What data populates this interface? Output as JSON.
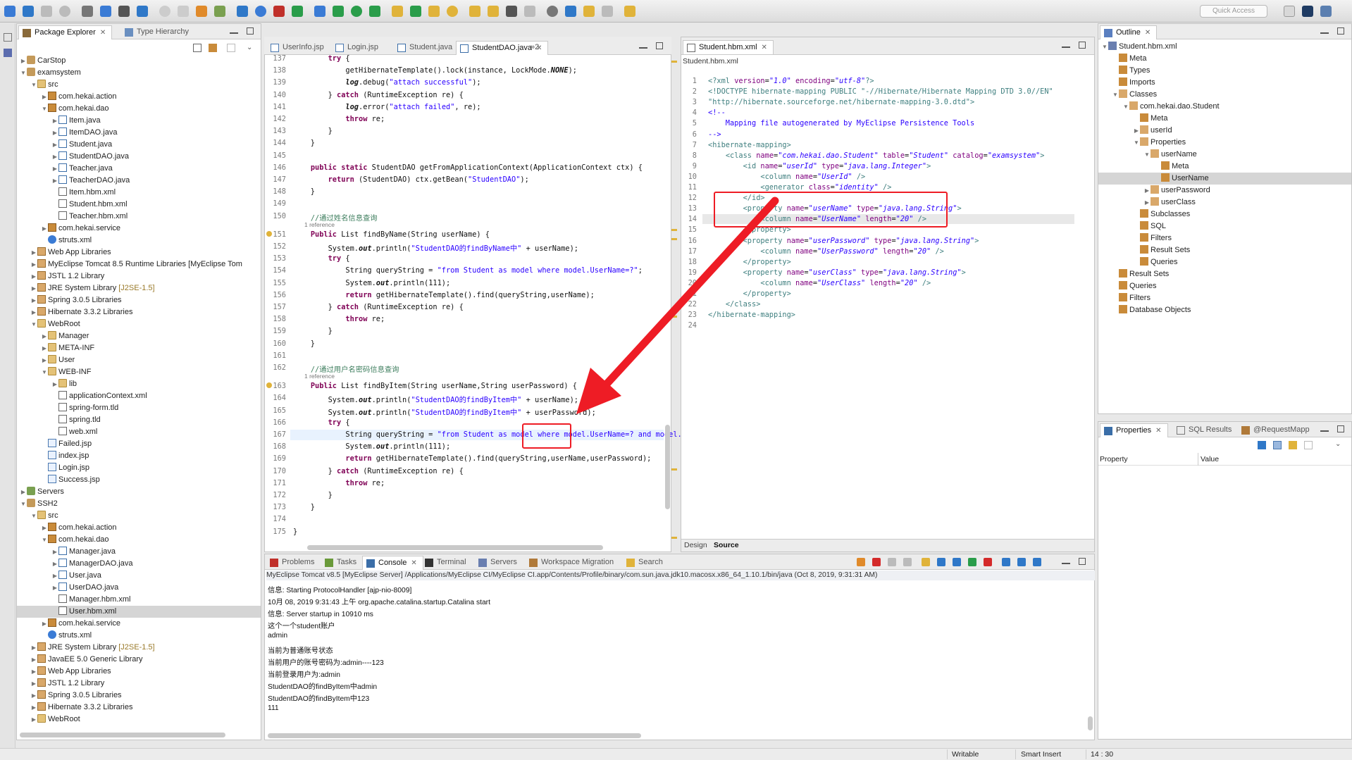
{
  "toolbar": {
    "quick_access_placeholder": "Quick Access"
  },
  "left": {
    "tabs": [
      {
        "label": "Package Explorer"
      },
      {
        "label": "Type Hierarchy"
      }
    ],
    "tree": [
      {
        "d": 0,
        "a": "▶",
        "i": "proj",
        "t": "CarStop"
      },
      {
        "d": 0,
        "a": "▼",
        "i": "proj",
        "t": "examsystem"
      },
      {
        "d": 1,
        "a": "▼",
        "i": "fold",
        "t": "src"
      },
      {
        "d": 2,
        "a": "▶",
        "i": "pkg",
        "t": "com.hekai.action"
      },
      {
        "d": 2,
        "a": "▼",
        "i": "pkg",
        "t": "com.hekai.dao"
      },
      {
        "d": 3,
        "a": "▶",
        "i": "java",
        "t": "Item.java"
      },
      {
        "d": 3,
        "a": "▶",
        "i": "java",
        "t": "ItemDAO.java"
      },
      {
        "d": 3,
        "a": "▶",
        "i": "java",
        "t": "Student.java"
      },
      {
        "d": 3,
        "a": "▶",
        "i": "java",
        "t": "StudentDAO.java"
      },
      {
        "d": 3,
        "a": "▶",
        "i": "java",
        "t": "Teacher.java"
      },
      {
        "d": 3,
        "a": "▶",
        "i": "java",
        "t": "TeacherDAO.java"
      },
      {
        "d": 3,
        "a": "",
        "i": "xml",
        "t": "Item.hbm.xml"
      },
      {
        "d": 3,
        "a": "",
        "i": "xml",
        "t": "Student.hbm.xml"
      },
      {
        "d": 3,
        "a": "",
        "i": "xml",
        "t": "Teacher.hbm.xml"
      },
      {
        "d": 2,
        "a": "▶",
        "i": "pkg",
        "t": "com.hekai.service"
      },
      {
        "d": 2,
        "a": "",
        "i": "gear",
        "t": "struts.xml"
      },
      {
        "d": 1,
        "a": "▶",
        "i": "lib",
        "t": "Web App Libraries"
      },
      {
        "d": 1,
        "a": "▶",
        "i": "lib",
        "t": "MyEclipse Tomcat 8.5 Runtime Libraries [MyEclipse Tom"
      },
      {
        "d": 1,
        "a": "▶",
        "i": "lib",
        "t": "JSTL 1.2 Library"
      },
      {
        "d": 1,
        "a": "▶",
        "i": "lib",
        "t": "JRE System Library ",
        "x": "[J2SE-1.5]"
      },
      {
        "d": 1,
        "a": "▶",
        "i": "lib",
        "t": "Spring 3.0.5 Libraries"
      },
      {
        "d": 1,
        "a": "▶",
        "i": "lib",
        "t": "Hibernate 3.3.2 Libraries"
      },
      {
        "d": 1,
        "a": "▼",
        "i": "fold",
        "t": "WebRoot"
      },
      {
        "d": 2,
        "a": "▶",
        "i": "fold",
        "t": "Manager"
      },
      {
        "d": 2,
        "a": "▶",
        "i": "fold",
        "t": "META-INF"
      },
      {
        "d": 2,
        "a": "▶",
        "i": "fold",
        "t": "User"
      },
      {
        "d": 2,
        "a": "▼",
        "i": "fold",
        "t": "WEB-INF"
      },
      {
        "d": 3,
        "a": "▶",
        "i": "fold",
        "t": "lib"
      },
      {
        "d": 3,
        "a": "",
        "i": "xml",
        "t": "applicationContext.xml"
      },
      {
        "d": 3,
        "a": "",
        "i": "xml",
        "t": "spring-form.tld"
      },
      {
        "d": 3,
        "a": "",
        "i": "xml",
        "t": "spring.tld"
      },
      {
        "d": 3,
        "a": "",
        "i": "xml",
        "t": "web.xml"
      },
      {
        "d": 2,
        "a": "",
        "i": "jsp",
        "t": "Failed.jsp"
      },
      {
        "d": 2,
        "a": "",
        "i": "jsp",
        "t": "index.jsp"
      },
      {
        "d": 2,
        "a": "",
        "i": "jsp",
        "t": "Login.jsp"
      },
      {
        "d": 2,
        "a": "",
        "i": "jsp",
        "t": "Success.jsp"
      },
      {
        "d": 0,
        "a": "▶",
        "i": "srv",
        "t": "Servers"
      },
      {
        "d": 0,
        "a": "▼",
        "i": "proj",
        "t": "SSH2"
      },
      {
        "d": 1,
        "a": "▼",
        "i": "fold",
        "t": "src"
      },
      {
        "d": 2,
        "a": "▶",
        "i": "pkg",
        "t": "com.hekai.action"
      },
      {
        "d": 2,
        "a": "▼",
        "i": "pkg",
        "t": "com.hekai.dao"
      },
      {
        "d": 3,
        "a": "▶",
        "i": "java",
        "t": "Manager.java"
      },
      {
        "d": 3,
        "a": "▶",
        "i": "java",
        "t": "ManagerDAO.java"
      },
      {
        "d": 3,
        "a": "▶",
        "i": "java",
        "t": "User.java"
      },
      {
        "d": 3,
        "a": "▶",
        "i": "java",
        "t": "UserDAO.java"
      },
      {
        "d": 3,
        "a": "",
        "i": "xml",
        "t": "Manager.hbm.xml"
      },
      {
        "d": 3,
        "a": "",
        "i": "xml",
        "t": "User.hbm.xml",
        "s": true
      },
      {
        "d": 2,
        "a": "▶",
        "i": "pkg",
        "t": "com.hekai.service"
      },
      {
        "d": 2,
        "a": "",
        "i": "gear",
        "t": "struts.xml"
      },
      {
        "d": 1,
        "a": "▶",
        "i": "lib",
        "t": "JRE System Library ",
        "x": "[J2SE-1.5]"
      },
      {
        "d": 1,
        "a": "▶",
        "i": "lib",
        "t": "JavaEE 5.0 Generic Library"
      },
      {
        "d": 1,
        "a": "▶",
        "i": "lib",
        "t": "Web App Libraries"
      },
      {
        "d": 1,
        "a": "▶",
        "i": "lib",
        "t": "JSTL 1.2 Library"
      },
      {
        "d": 1,
        "a": "▶",
        "i": "lib",
        "t": "Spring 3.0.5 Libraries"
      },
      {
        "d": 1,
        "a": "▶",
        "i": "lib",
        "t": "Hibernate 3.3.2 Libraries"
      },
      {
        "d": 1,
        "a": "▶",
        "i": "fold",
        "t": "WebRoot"
      }
    ]
  },
  "editor": {
    "tabs": [
      {
        "label": "UserInfo.jsp"
      },
      {
        "label": "Login.jsp"
      },
      {
        "label": "Student.java"
      },
      {
        "label": "StudentDAO.java"
      },
      {
        "label": "»2"
      }
    ],
    "lines": [
      {
        "n": "137",
        "h": "        <span class=kw>try</span> {"
      },
      {
        "n": "138",
        "h": "            getHibernateTemplate().lock(instance, LockMode.<i><b>NONE</b></i>);"
      },
      {
        "n": "139",
        "h": "            <i><b>log</b></i>.debug(<span class=str>\"attach successful\"</span>);"
      },
      {
        "n": "140",
        "h": "        } <span class=kw>catch</span> (RuntimeException re) {"
      },
      {
        "n": "141",
        "h": "            <i><b>log</b></i>.error(<span class=str>\"attach failed\"</span>, re);"
      },
      {
        "n": "142",
        "h": "            <span class=kw>throw</span> re;"
      },
      {
        "n": "143",
        "h": "        }"
      },
      {
        "n": "144",
        "h": "    }"
      },
      {
        "n": "145",
        "h": ""
      },
      {
        "n": "146",
        "h": "    <span class=kw>public static</span> StudentDAO getFromApplicationContext(ApplicationContext ctx) {"
      },
      {
        "n": "147",
        "h": "        <span class=kw>return</span> (StudentDAO) ctx.getBean(<span class=str>\"StudentDAO\"</span>);"
      },
      {
        "n": "148",
        "h": "    }"
      },
      {
        "n": "149",
        "h": ""
      },
      {
        "n": "150",
        "h": "    <span class=cm>//通过姓名信息查询</span>"
      },
      {
        "n": "151",
        "h": "    <span class=kw>Public</span> List findByName(String userName) {",
        "ref": "1 reference"
      },
      {
        "n": "152",
        "h": "        System.<i><b>out</b></i>.println(<span class=str>\"StudentDAO的findByName中\"</span> + userName);"
      },
      {
        "n": "153",
        "h": "        <span class=kw>try</span> {"
      },
      {
        "n": "154",
        "h": "            String queryString = <span class=str>\"from Student as model where model.UserName=?\"</span>;"
      },
      {
        "n": "155",
        "h": "            System.<i><b>out</b></i>.println(111);"
      },
      {
        "n": "156",
        "h": "            <span class=kw>return</span> getHibernateTemplate().find(queryString,userName);"
      },
      {
        "n": "157",
        "h": "        } <span class=kw>catch</span> (RuntimeException re) {"
      },
      {
        "n": "158",
        "h": "            <span class=kw>throw</span> re;"
      },
      {
        "n": "159",
        "h": "        }"
      },
      {
        "n": "160",
        "h": "    }"
      },
      {
        "n": "161",
        "h": ""
      },
      {
        "n": "162",
        "h": "    <span class=cm>//通过用户名密码信息查询</span>"
      },
      {
        "n": "163",
        "h": "    <span class=kw>Public</span> List findByItem(String userName,String userPassword) {",
        "ref": "1 reference"
      },
      {
        "n": "164",
        "h": "        System.<i><b>out</b></i>.println(<span class=str>\"StudentDAO的findByItem中\"</span> + userName);"
      },
      {
        "n": "165",
        "h": "        System.<i><b>out</b></i>.println(<span class=str>\"StudentDAO的findByItem中\"</span> + userPassword);"
      },
      {
        "n": "166",
        "h": "        <span class=kw>try</span> {"
      },
      {
        "n": "167",
        "h": "            String queryString = <span class=str>\"from Student as model where model.UserName=? and model.userPasswo</span>",
        "hl": true
      },
      {
        "n": "168",
        "h": "            System.<i><b>out</b></i>.println(111);"
      },
      {
        "n": "169",
        "h": "            <span class=kw>return</span> getHibernateTemplate().find(queryString,userName,userPassword);"
      },
      {
        "n": "170",
        "h": "        } <span class=kw>catch</span> (RuntimeException re) {"
      },
      {
        "n": "171",
        "h": "            <span class=kw>throw</span> re;"
      },
      {
        "n": "172",
        "h": "        }"
      },
      {
        "n": "173",
        "h": "    }"
      },
      {
        "n": "174",
        "h": ""
      },
      {
        "n": "175",
        "h": "}"
      }
    ]
  },
  "xml": {
    "tab": "Student.hbm.xml",
    "breadcrumb": "Student.hbm.xml",
    "bottom_tabs": [
      {
        "label": "Design"
      },
      {
        "label": "Source"
      }
    ],
    "lines": [
      {
        "n": "1",
        "h": "<span class=xt>&lt;?xml</span> <span class=xa>version</span>=<span class=xv>\"1.0\"</span> <span class=xa>encoding</span>=<span class=xv>\"utf-8\"</span><span class=xt>?&gt;</span>"
      },
      {
        "n": "2",
        "h": "<span class=xt>&lt;!DOCTYPE hibernate-mapping PUBLIC \"-//Hibernate/Hibernate Mapping DTD 3.0//EN\"</span>"
      },
      {
        "n": "3",
        "h": "<span class=xt>\"http://hibernate.sourceforge.net/hibernate-mapping-3.0.dtd\"&gt;</span>"
      },
      {
        "n": "4",
        "h": "<span class=str>&lt;!--</span>"
      },
      {
        "n": "5",
        "h": "<span class=str>    Mapping file autogenerated by MyEclipse Persistence Tools</span>"
      },
      {
        "n": "6",
        "h": "<span class=str>--&gt;</span>"
      },
      {
        "n": "7",
        "h": "<span class=xt>&lt;hibernate-mapping&gt;</span>"
      },
      {
        "n": "8",
        "h": "    <span class=xt>&lt;class</span> <span class=xa>name</span>=<span class=xv>\"com.hekai.dao.Student\"</span> <span class=xa>table</span>=<span class=xv>\"Student\"</span> <span class=xa>catalog</span>=<span class=xv>\"examsystem\"</span><span class=xt>&gt;</span>"
      },
      {
        "n": "9",
        "h": "        <span class=xt>&lt;id</span> <span class=xa>name</span>=<span class=xv>\"userId\"</span> <span class=xa>type</span>=<span class=xv>\"java.lang.Integer\"</span><span class=xt>&gt;</span>"
      },
      {
        "n": "10",
        "h": "            <span class=xt>&lt;column</span> <span class=xa>name</span>=<span class=xv>\"UserId\"</span> <span class=xt>/&gt;</span>"
      },
      {
        "n": "11",
        "h": "            <span class=xt>&lt;generator</span> <span class=xa>class</span>=<span class=xv>\"identity\"</span> <span class=xt>/&gt;</span>"
      },
      {
        "n": "12",
        "h": "        <span class=xt>&lt;/id&gt;</span>"
      },
      {
        "n": "13",
        "h": "        <span class=xt>&lt;property</span> <span class=xa>name</span>=<span class=xv>\"userName\"</span> <span class=xa>type</span>=<span class=xv>\"java.lang.String\"</span><span class=xt>&gt;</span>"
      },
      {
        "n": "14",
        "h": "            <span class=xt>&lt;column</span> <span class=xa>name</span>=<span class=xv>\"UserName\"</span> <span class=xa>length</span>=<span class=xv>\"20\"</span> <span class=xt>/&gt;</span>",
        "hl": true
      },
      {
        "n": "15",
        "h": "        <span class=xt>&lt;/property&gt;</span>"
      },
      {
        "n": "16",
        "h": "        <span class=xt>&lt;property</span> <span class=xa>name</span>=<span class=xv>\"userPassword\"</span> <span class=xa>type</span>=<span class=xv>\"java.lang.String\"</span><span class=xt>&gt;</span>"
      },
      {
        "n": "17",
        "h": "            <span class=xt>&lt;column</span> <span class=xa>name</span>=<span class=xv>\"UserPassword\"</span> <span class=xa>length</span>=<span class=xv>\"20\"</span> <span class=xt>/&gt;</span>"
      },
      {
        "n": "18",
        "h": "        <span class=xt>&lt;/property&gt;</span>"
      },
      {
        "n": "19",
        "h": "        <span class=xt>&lt;property</span> <span class=xa>name</span>=<span class=xv>\"userClass\"</span> <span class=xa>type</span>=<span class=xv>\"java.lang.String\"</span><span class=xt>&gt;</span>"
      },
      {
        "n": "20",
        "h": "            <span class=xt>&lt;column</span> <span class=xa>name</span>=<span class=xv>\"UserClass\"</span> <span class=xa>length</span>=<span class=xv>\"20\"</span> <span class=xt>/&gt;</span>"
      },
      {
        "n": "21",
        "h": "        <span class=xt>&lt;/property&gt;</span>"
      },
      {
        "n": "22",
        "h": "    <span class=xt>&lt;/class&gt;</span>"
      },
      {
        "n": "23",
        "h": "<span class=xt>&lt;/hibernate-mapping&gt;</span>"
      },
      {
        "n": "24",
        "h": ""
      }
    ]
  },
  "outline": {
    "tab": "Outline",
    "tree": [
      {
        "d": 0,
        "a": "▼",
        "t": "Student.hbm.xml"
      },
      {
        "d": 1,
        "a": "",
        "t": "Meta"
      },
      {
        "d": 1,
        "a": "",
        "t": "Types"
      },
      {
        "d": 1,
        "a": "",
        "t": "Imports"
      },
      {
        "d": 1,
        "a": "▼",
        "t": "Classes"
      },
      {
        "d": 2,
        "a": "▼",
        "t": "com.hekai.dao.Student"
      },
      {
        "d": 3,
        "a": "",
        "t": "Meta"
      },
      {
        "d": 3,
        "a": "▶",
        "t": "userId"
      },
      {
        "d": 3,
        "a": "▼",
        "t": "Properties"
      },
      {
        "d": 4,
        "a": "▼",
        "t": "userName"
      },
      {
        "d": 5,
        "a": "",
        "t": "Meta"
      },
      {
        "d": 5,
        "a": "",
        "t": "UserName",
        "s": true
      },
      {
        "d": 4,
        "a": "▶",
        "t": "userPassword"
      },
      {
        "d": 4,
        "a": "▶",
        "t": "userClass"
      },
      {
        "d": 3,
        "a": "",
        "t": "Subclasses"
      },
      {
        "d": 3,
        "a": "",
        "t": "SQL"
      },
      {
        "d": 3,
        "a": "",
        "t": "Filters"
      },
      {
        "d": 3,
        "a": "",
        "t": "Result Sets"
      },
      {
        "d": 3,
        "a": "",
        "t": "Queries"
      },
      {
        "d": 1,
        "a": "",
        "t": "Result Sets"
      },
      {
        "d": 1,
        "a": "",
        "t": "Queries"
      },
      {
        "d": 1,
        "a": "",
        "t": "Filters"
      },
      {
        "d": 1,
        "a": "",
        "t": "Database Objects"
      }
    ]
  },
  "properties": {
    "tabs": [
      {
        "label": "Properties"
      },
      {
        "label": "SQL Results"
      },
      {
        "label": "@RequestMapp"
      }
    ],
    "col_property": "Property",
    "col_value": "Value"
  },
  "console": {
    "tabs": [
      {
        "label": "Problems"
      },
      {
        "label": "Tasks"
      },
      {
        "label": "Console"
      },
      {
        "label": "Terminal"
      },
      {
        "label": "Servers"
      },
      {
        "label": "Workspace Migration"
      },
      {
        "label": "Search"
      }
    ],
    "header": "MyEclipse Tomcat v8.5 [MyEclipse Server] /Applications/MyEclipse CI/MyEclipse CI.app/Contents/Profile/binary/com.sun.java.jdk10.macosx.x86_64_1.10.1/bin/java (Oct 8, 2019, 9:31:31 AM)",
    "lines": [
      "信息: Starting ProtocolHandler [ajp-nio-8009]",
      "10月 08, 2019 9:31:43 上午 org.apache.catalina.startup.Catalina start",
      "信息: Server startup in 10910 ms",
      "这个一个student账户",
      "admin",
      "当前为普通账号状态",
      "当前用户的账号密码为:admin----123",
      "当前登录用户为:admin",
      "StudentDAO的findByItem中admin",
      "StudentDAO的findByItem中123",
      "111"
    ]
  },
  "status": {
    "writable": "Writable",
    "insert": "Smart Insert",
    "position": "14 : 30"
  }
}
